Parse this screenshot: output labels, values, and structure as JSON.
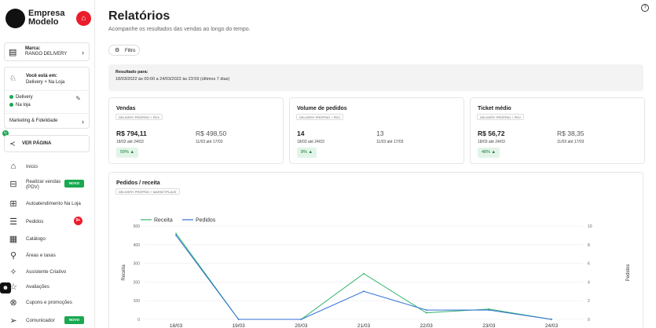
{
  "brand": {
    "name": "Empresa Modelo"
  },
  "marca": {
    "label": "Marca:",
    "value": "RANGO DELIVERY"
  },
  "estado": {
    "label": "Você está em:",
    "value": "Delivery + Na Loja",
    "channels": [
      "Delivery",
      "Na loja"
    ],
    "marketing": "Marketing & Fidelidade"
  },
  "ver_pagina": "VER PÁGINA",
  "nav": [
    {
      "label": "Início",
      "icon": "home-icon"
    },
    {
      "label": "Realizar vendas (PDV)",
      "icon": "cart-icon",
      "badge": "NOVO"
    },
    {
      "label": "Autoatendimento Na Loja",
      "icon": "kiosk-icon"
    },
    {
      "label": "Pedidos",
      "icon": "orders-icon",
      "count": "9+"
    },
    {
      "label": "Catálogo",
      "icon": "catalog-icon"
    },
    {
      "label": "Áreas e taxas",
      "icon": "location-icon"
    },
    {
      "label": "Assistente Criativo",
      "icon": "magic-icon"
    },
    {
      "label": "Avaliações",
      "icon": "star-icon"
    },
    {
      "label": "Cupons e promoções",
      "icon": "coupon-icon"
    },
    {
      "label": "Comunicador",
      "icon": "send-icon",
      "badge": "NOVO"
    }
  ],
  "header": {
    "title": "Relatórios",
    "subtitle": "Acompanhe os resultados das vendas ao longo do tempo.",
    "filter": "Filtro"
  },
  "result": {
    "title": "Resultado para:",
    "text": "18/03/2022 às 00:00 a 24/03/2022 às 23:59 (últimos 7 dias)"
  },
  "cards": [
    {
      "title": "Vendas",
      "chip": "DELIVERY PRÓPRIO + PDV",
      "value": "R$ 794,11",
      "value_range": "18/03 até 24/03",
      "compare": "R$ 498,50",
      "compare_range": "11/03 até 17/03",
      "pct": "59%"
    },
    {
      "title": "Volume de pedidos",
      "chip": "DELIVERY PRÓPRIO + PDV",
      "value": "14",
      "value_range": "18/03 até 24/03",
      "compare": "13",
      "compare_range": "11/03 até 17/03",
      "pct": "8%"
    },
    {
      "title": "Ticket médio",
      "chip": "DELIVERY PRÓPRIO + PDV",
      "value": "R$ 56,72",
      "value_range": "18/03 até 24/03",
      "compare": "R$ 38,35",
      "compare_range": "11/03 até 17/03",
      "pct": "48%"
    }
  ],
  "chart_card": {
    "title": "Pedidos / receita",
    "chip": "DELIVERY PRÓPRIO + MARKETPLACE"
  },
  "colors": {
    "accent_red": "#ea1d2c",
    "green": "#1aa851",
    "receita": "#2fb36a",
    "pedidos": "#2f6fd6"
  },
  "chart_data": {
    "type": "line",
    "title": "",
    "categories": [
      "18/03",
      "19/03",
      "20/03",
      "21/03",
      "22/03",
      "23/03",
      "24/03"
    ],
    "series": [
      {
        "name": "Receita",
        "axis": "left",
        "values": [
          460,
          0,
          0,
          245,
          35,
          55,
          0
        ]
      },
      {
        "name": "Pedidos",
        "axis": "right",
        "values": [
          9,
          0,
          0,
          3,
          1,
          1,
          0
        ]
      }
    ],
    "ylabel": "Receita",
    "y2label": "Pedidos",
    "ylim": [
      0,
      500
    ],
    "y2lim": [
      0,
      10
    ],
    "yticks": [
      0,
      100,
      200,
      300,
      400,
      500
    ],
    "y2ticks": [
      0,
      2,
      4,
      6,
      8,
      10
    ],
    "grid": true,
    "legend": "top-left"
  }
}
